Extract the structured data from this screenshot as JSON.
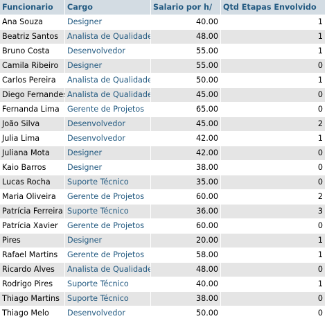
{
  "columns": [
    "Funcionario",
    "Cargo",
    "Salario por h/",
    "Qtd Etapas Envolvido"
  ],
  "rows": [
    [
      "Ana Souza",
      "Designer",
      "40.00",
      "1"
    ],
    [
      "Beatriz Santos",
      "Analista de Qualidade",
      "48.00",
      "1"
    ],
    [
      "Bruno Costa",
      "Desenvolvedor",
      "55.00",
      "1"
    ],
    [
      "Camila Ribeiro",
      "Designer",
      "55.00",
      "0"
    ],
    [
      "Carlos Pereira",
      "Analista de Qualidade",
      "50.00",
      "1"
    ],
    [
      "Diego Fernandes",
      "Analista de Qualidade",
      "45.00",
      "0"
    ],
    [
      "Fernanda Lima",
      "Gerente de Projetos",
      "65.00",
      "0"
    ],
    [
      "João Silva",
      "Desenvolvedor",
      "45.00",
      "2"
    ],
    [
      "Julia Lima",
      "Desenvolvedor",
      "42.00",
      "1"
    ],
    [
      "Juliana Mota",
      "Designer",
      "42.00",
      "0"
    ],
    [
      "Kaio Barros",
      "Designer",
      "38.00",
      "0"
    ],
    [
      "Lucas Rocha",
      "Suporte Técnico",
      "35.00",
      "0"
    ],
    [
      "Maria Oliveira",
      "Gerente de Projetos",
      "60.00",
      "2"
    ],
    [
      "Patrícia Ferreira",
      "Suporte Técnico",
      "36.00",
      "3"
    ],
    [
      "Patrícia Xavier",
      "Gerente de Projetos",
      "60.00",
      "0"
    ],
    [
      "Pires",
      "Designer",
      "20.00",
      "1"
    ],
    [
      "Rafael Martins",
      "Gerente de Projetos",
      "58.00",
      "1"
    ],
    [
      "Ricardo Alves",
      "Analista de Qualidade",
      "48.00",
      "0"
    ],
    [
      "Rodrigo Pires",
      "Suporte Técnico",
      "40.00",
      "1"
    ],
    [
      "Thiago Martins",
      "Suporte Técnico",
      "38.00",
      "0"
    ],
    [
      "Thiago Melo",
      "Desenvolvedor",
      "50.00",
      "0"
    ]
  ]
}
